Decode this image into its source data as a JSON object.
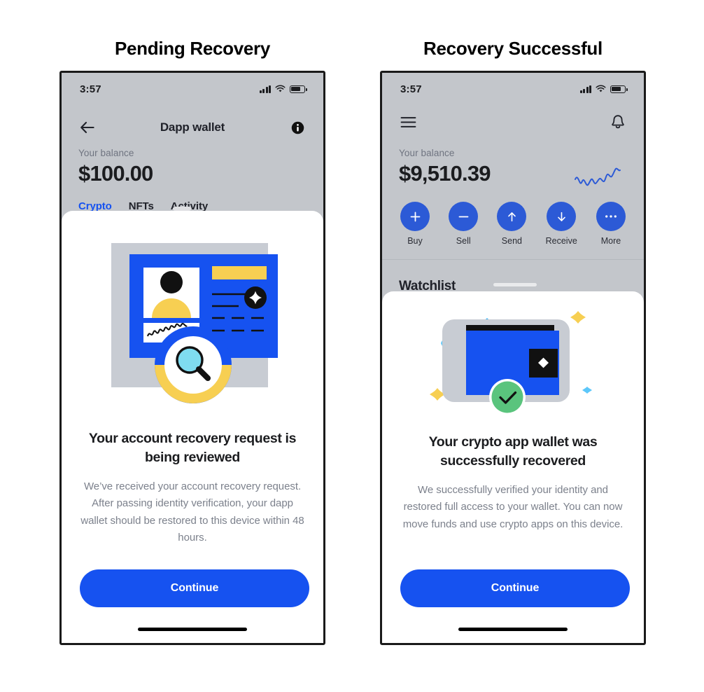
{
  "page": {
    "background": "#ffffff",
    "accent_blue": "#1652f0",
    "status_green": "#5ac47d",
    "accent_yellow": "#f7cf52",
    "accent_cyan": "#7fdcf0"
  },
  "panels": [
    {
      "caption": "Pending Recovery",
      "phone": {
        "status_bar": {
          "time": "3:57",
          "signal_icon": "cellular-bars-icon",
          "wifi_icon": "wifi-icon",
          "battery_icon": "battery-icon"
        },
        "nav": {
          "back_icon": "arrow-left-icon",
          "title": "Dapp wallet",
          "info_icon": "info-circle-icon"
        },
        "balance": {
          "label": "Your balance",
          "value": "$100.00"
        },
        "tabs": [
          {
            "label": "Crypto",
            "active": true
          },
          {
            "label": "NFTs",
            "active": false
          },
          {
            "label": "Activity",
            "active": false
          }
        ]
      },
      "sheet": {
        "illustration": "id-card-magnifier-illustration",
        "title": "Your  account recovery request is being reviewed",
        "body": "We’ve received your account recovery request. After passing identity verification, your dapp wallet should be restored to this device within 48 hours.",
        "cta_label": "Continue"
      }
    },
    {
      "caption": "Recovery Successful",
      "phone": {
        "status_bar": {
          "time": "3:57",
          "signal_icon": "cellular-bars-icon",
          "wifi_icon": "wifi-icon",
          "battery_icon": "battery-icon"
        },
        "nav": {
          "menu_icon": "hamburger-menu-icon",
          "title": "",
          "bell_icon": "bell-icon"
        },
        "balance": {
          "label": "Your balance",
          "value": "$9,510.39",
          "sparkline_icon": "sparkline-chart-icon"
        },
        "actions": [
          {
            "label": "Buy",
            "icon": "plus-icon"
          },
          {
            "label": "Sell",
            "icon": "minus-icon"
          },
          {
            "label": "Send",
            "icon": "arrow-up-icon"
          },
          {
            "label": "Receive",
            "icon": "arrow-down-icon"
          },
          {
            "label": "More",
            "icon": "ellipsis-icon"
          }
        ],
        "watchlist_heading": "Watchlist"
      },
      "sheet": {
        "illustration": "wallet-check-sparkles-illustration",
        "title": "Your crypto app wallet was successfully recovered",
        "body": "We successfully verified your identity and restored full access to your wallet. You can now move funds and use crypto apps on this device.",
        "cta_label": "Continue"
      }
    }
  ]
}
